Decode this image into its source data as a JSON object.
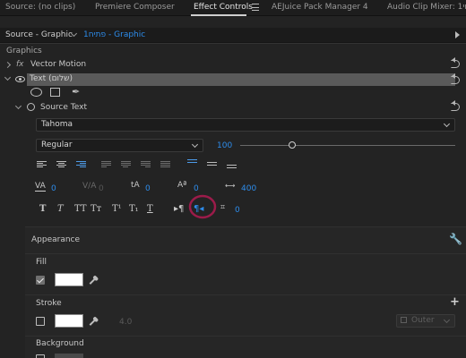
{
  "tabs": [
    {
      "label": "Source: (no clips)"
    },
    {
      "label": "Premiere Composer"
    },
    {
      "label": "Effect Controls"
    },
    {
      "label": "AEJuice Pack Manager 4"
    },
    {
      "label": "Audio Clip Mixer: 1חי"
    }
  ],
  "source_bar": {
    "source_label": "Source - Graphic",
    "sequence_label": "1פתיח - Graphic"
  },
  "panel": {
    "section_title": "Graphics",
    "vector_motion": "Vector Motion",
    "fx_label": "fx",
    "layer_name": "Text (שלום)",
    "source_text": "Source Text",
    "font": "Tahoma",
    "font_style": "Regular",
    "font_size": "100",
    "kerning": "0",
    "tracking": "0",
    "leading": "0",
    "baseline": "0",
    "tab_width": "400",
    "tsume": "0",
    "faux_styles": [
      "T",
      "T",
      "TT",
      "Tт",
      "T¹",
      "T₁",
      "T"
    ],
    "appearance": "Appearance",
    "fill": "Fill",
    "stroke": "Stroke",
    "stroke_width": "4.0",
    "stroke_type": "Outer",
    "background": "Background"
  },
  "annotation_color": "#9b1b4a",
  "accent_color": "#2d8ceb"
}
